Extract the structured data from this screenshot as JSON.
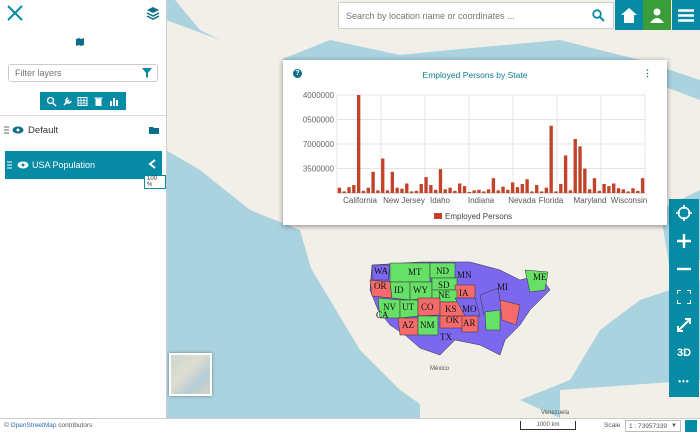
{
  "search": {
    "placeholder": "Search by location name or coordinates ..."
  },
  "sidebar": {
    "filter_placeholder": "Filter layers",
    "group": {
      "label": "Default"
    },
    "layer": {
      "label": "USA Population",
      "opacity": "100 %"
    }
  },
  "widget": {
    "title": "Employed Persons by State",
    "legend": "Employed Persons"
  },
  "map": {
    "country_label": "México",
    "country_label2": "Venezuela",
    "states": [
      "WA",
      "MT",
      "ND",
      "MN",
      "OR",
      "ID",
      "SD",
      "WY",
      "IA",
      "NV",
      "UT",
      "NE",
      "CO",
      "KS",
      "MO",
      "AZ",
      "NM",
      "OK",
      "AR",
      "TX",
      "ME",
      "MI",
      "CA"
    ]
  },
  "controls": {
    "zoom_3d": "3D",
    "more": "•••"
  },
  "footer": {
    "attribution_prefix": "© ",
    "attribution_link": "OpenStreetMap",
    "attribution_suffix": " contributors",
    "scalebar": "1000 km",
    "scale_label": "Scale",
    "scale_value": "1 : 73957339"
  },
  "colors": {
    "accent": "#078aa3",
    "bar": "#c0432a",
    "home_green": "#3a9d3a"
  },
  "chart_data": {
    "type": "bar",
    "title": "Employed Persons by State",
    "series": [
      {
        "name": "Employed Persons",
        "values": [
          1000000,
          300000,
          1100000,
          1500000,
          18500000,
          400000,
          1000000,
          4000000,
          500000,
          6500000,
          500000,
          4000000,
          1000000,
          800000,
          1800000,
          300000,
          400000,
          1700000,
          3000000,
          1500000,
          600000,
          4500000,
          700000,
          1000000,
          400000,
          1800000,
          1300000,
          200000,
          500000,
          600000,
          300000,
          700000,
          2800000,
          500000,
          1200000,
          600000,
          2000000,
          1100000,
          1700000,
          2600000,
          300000,
          1500000,
          300000,
          1000000,
          12700000,
          300000,
          1700000,
          7100000,
          500000,
          10200000,
          8800000,
          4600000,
          700000,
          2800000,
          400000,
          1700000,
          1300000,
          1800000,
          900000,
          700000,
          300000,
          900000,
          400000,
          2800000
        ]
      }
    ],
    "xtick_labels": [
      "California",
      "New Jersey",
      "Idaho",
      "Indiana",
      "Nevada",
      "Florida",
      "Maryland",
      "Wisconsin"
    ],
    "ytick_labels": [
      "4000000",
      "0500000",
      "7000000",
      "3500000"
    ],
    "ylim": [
      0,
      18500000
    ]
  }
}
